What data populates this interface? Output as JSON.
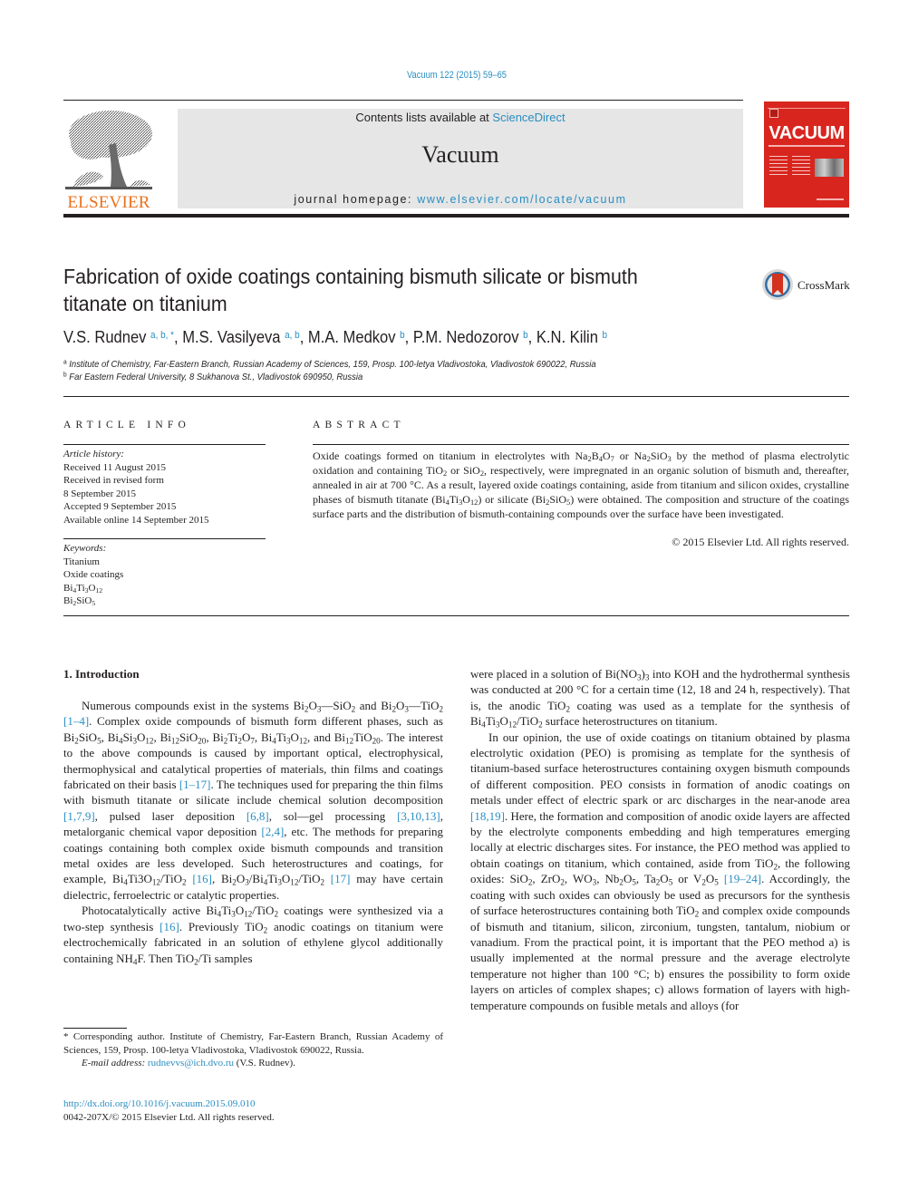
{
  "header": {
    "citation": "Vacuum 122 (2015) 59–65",
    "publisher_wordmark": "ELSEVIER",
    "contents_prefix": "Contents lists available at ",
    "contents_link": "ScienceDirect",
    "journal_title": "Vacuum",
    "homepage_prefix": "journal homepage: ",
    "homepage_link": "www.elsevier.com/locate/vacuum",
    "cover_title": "VACUUM",
    "crossmark_label": "CrossMark",
    "colors": {
      "link": "#2a8ec2",
      "elsevier_orange": "#e9711c",
      "cover_red": "#d8261f",
      "header_gray": "#e6e6e6"
    }
  },
  "article": {
    "title": "Fabrication of oxide coatings containing bismuth silicate or bismuth titanate on titanium",
    "authors": [
      {
        "name": "V.S. Rudnev",
        "marks": "a, b, *"
      },
      {
        "name": "M.S. Vasilyeva",
        "marks": "a, b"
      },
      {
        "name": "M.A. Medkov",
        "marks": "b"
      },
      {
        "name": "P.M. Nedozorov",
        "marks": "b"
      },
      {
        "name": "K.N. Kilin",
        "marks": "b"
      }
    ],
    "affiliations": [
      {
        "mark": "a",
        "text": "Institute of Chemistry, Far-Eastern Branch, Russian Academy of Sciences, 159, Prosp. 100-letya Vladivostoka, Vladivostok 690022, Russia"
      },
      {
        "mark": "b",
        "text": "Far Eastern Federal University, 8 Sukhanova St., Vladivostok 690950, Russia"
      }
    ]
  },
  "article_info": {
    "heading": "ARTICLE INFO",
    "history_label": "Article history:",
    "history": [
      "Received 11 August 2015",
      "Received in revised form",
      "8 September 2015",
      "Accepted 9 September 2015",
      "Available online 14 September 2015"
    ],
    "keywords_label": "Keywords:",
    "keywords": [
      [
        [
          "t",
          "Titanium"
        ]
      ],
      [
        [
          "t",
          "Oxide coatings"
        ]
      ],
      [
        [
          "t",
          "Bi"
        ],
        [
          "s",
          "4"
        ],
        [
          "t",
          "Ti"
        ],
        [
          "s",
          "3"
        ],
        [
          "t",
          "O"
        ],
        [
          "s",
          "12"
        ]
      ],
      [
        [
          "t",
          "Bi"
        ],
        [
          "s",
          "2"
        ],
        [
          "t",
          "SiO"
        ],
        [
          "s",
          "5"
        ]
      ]
    ]
  },
  "abstract": {
    "heading": "ABSTRACT",
    "text": [
      [
        "t",
        "Oxide coatings formed on titanium in electrolytes with Na"
      ],
      [
        "s",
        "2"
      ],
      [
        "t",
        "B"
      ],
      [
        "s",
        "4"
      ],
      [
        "t",
        "O"
      ],
      [
        "s",
        "7"
      ],
      [
        "t",
        " or Na"
      ],
      [
        "s",
        "2"
      ],
      [
        "t",
        "SiO"
      ],
      [
        "s",
        "3"
      ],
      [
        "t",
        " by the method of plasma electrolytic oxidation and containing TiO"
      ],
      [
        "s",
        "2"
      ],
      [
        "t",
        " or SiO"
      ],
      [
        "s",
        "2"
      ],
      [
        "t",
        ", respectively, were impregnated in an organic solution of bismuth and, thereafter, annealed in air at 700 °C. As a result, layered oxide coatings containing, aside from titanium and silicon oxides, crystalline phases of bismuth titanate (Bi"
      ],
      [
        "s",
        "4"
      ],
      [
        "t",
        "Ti"
      ],
      [
        "s",
        "3"
      ],
      [
        "t",
        "O"
      ],
      [
        "s",
        "12"
      ],
      [
        "t",
        ") or silicate (Bi"
      ],
      [
        "s",
        "2"
      ],
      [
        "t",
        "SiO"
      ],
      [
        "s",
        "5"
      ],
      [
        "t",
        ") were obtained. The composition and structure of the coatings surface parts and the distribution of bismuth-containing compounds over the surface have been investigated."
      ]
    ],
    "copyright": "© 2015 Elsevier Ltd. All rights reserved."
  },
  "body": {
    "section_heading": "1.  Introduction",
    "left_paragraphs": [
      [
        [
          "t",
          "Numerous compounds exist in the systems Bi"
        ],
        [
          "s",
          "2"
        ],
        [
          "t",
          "O"
        ],
        [
          "s",
          "3"
        ],
        [
          "t",
          "—SiO"
        ],
        [
          "s",
          "2"
        ],
        [
          "t",
          " and Bi"
        ],
        [
          "s",
          "2"
        ],
        [
          "t",
          "O"
        ],
        [
          "s",
          "3"
        ],
        [
          "t",
          "—TiO"
        ],
        [
          "s",
          "2"
        ],
        [
          "t",
          " "
        ],
        [
          "l",
          "[1–4]"
        ],
        [
          "t",
          ". Complex oxide compounds of bismuth form different phases, such as Bi"
        ],
        [
          "s",
          "2"
        ],
        [
          "t",
          "SiO"
        ],
        [
          "s",
          "5"
        ],
        [
          "t",
          ", Bi"
        ],
        [
          "s",
          "4"
        ],
        [
          "t",
          "Si"
        ],
        [
          "s",
          "3"
        ],
        [
          "t",
          "O"
        ],
        [
          "s",
          "12"
        ],
        [
          "t",
          ", Bi"
        ],
        [
          "s",
          "12"
        ],
        [
          "t",
          "SiO"
        ],
        [
          "s",
          "20"
        ],
        [
          "t",
          ", Bi"
        ],
        [
          "s",
          "2"
        ],
        [
          "t",
          "Ti"
        ],
        [
          "s",
          "2"
        ],
        [
          "t",
          "O"
        ],
        [
          "s",
          "7"
        ],
        [
          "t",
          ", Bi"
        ],
        [
          "s",
          "4"
        ],
        [
          "t",
          "Ti"
        ],
        [
          "s",
          "3"
        ],
        [
          "t",
          "O"
        ],
        [
          "s",
          "12"
        ],
        [
          "t",
          ", and Bi"
        ],
        [
          "s",
          "12"
        ],
        [
          "t",
          "TiO"
        ],
        [
          "s",
          "20"
        ],
        [
          "t",
          ". The interest to the above compounds is caused by important optical, electrophysical, thermophysical and catalytical properties of materials, thin films and coatings fabricated on their basis "
        ],
        [
          "l",
          "[1–17]"
        ],
        [
          "t",
          ". The techniques used for preparing the thin films with bismuth titanate or silicate include chemical solution decomposition "
        ],
        [
          "l",
          "[1,7,9]"
        ],
        [
          "t",
          ", pulsed laser deposition "
        ],
        [
          "l",
          "[6,8]"
        ],
        [
          "t",
          ", sol—gel processing "
        ],
        [
          "l",
          "[3,10,13]"
        ],
        [
          "t",
          ", metalorganic chemical vapor deposition "
        ],
        [
          "l",
          "[2,4]"
        ],
        [
          "t",
          ", etc. The methods for preparing coatings containing both complex oxide bismuth compounds and transition metal oxides are less developed. Such heterostructures and coatings, for example, Bi"
        ],
        [
          "s",
          "4"
        ],
        [
          "t",
          "Ti3O"
        ],
        [
          "s",
          "12"
        ],
        [
          "t",
          "/TiO"
        ],
        [
          "s",
          "2"
        ],
        [
          "t",
          " "
        ],
        [
          "l",
          "[16]"
        ],
        [
          "t",
          ", Bi"
        ],
        [
          "s",
          "2"
        ],
        [
          "t",
          "O"
        ],
        [
          "s",
          "3"
        ],
        [
          "t",
          "/Bi"
        ],
        [
          "s",
          "4"
        ],
        [
          "t",
          "Ti"
        ],
        [
          "s",
          "3"
        ],
        [
          "t",
          "O"
        ],
        [
          "s",
          "12"
        ],
        [
          "t",
          "/TiO"
        ],
        [
          "s",
          "2"
        ],
        [
          "t",
          " "
        ],
        [
          "l",
          "[17]"
        ],
        [
          "t",
          " may have certain dielectric, ferroelectric or catalytic properties."
        ]
      ],
      [
        [
          "t",
          "Photocatalytically active Bi"
        ],
        [
          "s",
          "4"
        ],
        [
          "t",
          "Ti"
        ],
        [
          "s",
          "3"
        ],
        [
          "t",
          "O"
        ],
        [
          "s",
          "12"
        ],
        [
          "t",
          "/TiO"
        ],
        [
          "s",
          "2"
        ],
        [
          "t",
          " coatings were synthesized via a two-step synthesis "
        ],
        [
          "l",
          "[16]"
        ],
        [
          "t",
          ". Previously TiO"
        ],
        [
          "s",
          "2"
        ],
        [
          "t",
          " anodic coatings on titanium were electrochemically fabricated in an solution of ethylene glycol additionally containing NH"
        ],
        [
          "s",
          "4"
        ],
        [
          "t",
          "F. Then TiO"
        ],
        [
          "s",
          "2"
        ],
        [
          "t",
          "/Ti samples"
        ]
      ]
    ],
    "right_paragraphs": [
      [
        [
          "t",
          "were placed in a solution of Bi(NO"
        ],
        [
          "s",
          "3"
        ],
        [
          "t",
          ")"
        ],
        [
          "s",
          "3"
        ],
        [
          "t",
          " into KOH and the hydrothermal synthesis was conducted at 200 °C for a certain time (12, 18 and 24 h, respectively). That is, the anodic TiO"
        ],
        [
          "s",
          "2"
        ],
        [
          "t",
          " coating was used as a template for the synthesis of Bi"
        ],
        [
          "s",
          "4"
        ],
        [
          "t",
          "Ti"
        ],
        [
          "s",
          "3"
        ],
        [
          "t",
          "O"
        ],
        [
          "s",
          "12"
        ],
        [
          "t",
          "/TiO"
        ],
        [
          "s",
          "2"
        ],
        [
          "t",
          " surface heterostructures on titanium."
        ]
      ],
      [
        [
          "t",
          "In our opinion, the use of oxide coatings on titanium obtained by plasma electrolytic oxidation (PEO) is promising as template for the synthesis of titanium-based surface heterostructures containing oxygen bismuth compounds of different composition. PEO consists in formation of anodic coatings on metals under effect of electric spark or arc discharges in the near-anode area "
        ],
        [
          "l",
          "[18,19]"
        ],
        [
          "t",
          ". Here, the formation and composition of anodic oxide layers are affected by the electrolyte components embedding and high temperatures emerging locally at electric discharges sites. For instance, the PEO method was applied to obtain coatings on titanium, which contained, aside from TiO"
        ],
        [
          "s",
          "2"
        ],
        [
          "t",
          ", the following oxides: SiO"
        ],
        [
          "s",
          "2"
        ],
        [
          "t",
          ", ZrO"
        ],
        [
          "s",
          "2"
        ],
        [
          "t",
          ", WO"
        ],
        [
          "s",
          "3"
        ],
        [
          "t",
          ", Nb"
        ],
        [
          "s",
          "2"
        ],
        [
          "t",
          "O"
        ],
        [
          "s",
          "5"
        ],
        [
          "t",
          ", Ta"
        ],
        [
          "s",
          "2"
        ],
        [
          "t",
          "O"
        ],
        [
          "s",
          "5"
        ],
        [
          "t",
          " or V"
        ],
        [
          "s",
          "2"
        ],
        [
          "t",
          "O"
        ],
        [
          "s",
          "5"
        ],
        [
          "t",
          " "
        ],
        [
          "l",
          "[19–24]"
        ],
        [
          "t",
          ". Accordingly, the coating with such oxides can obviously be used as precursors for the synthesis of surface heterostructures containing both TiO"
        ],
        [
          "s",
          "2"
        ],
        [
          "t",
          " and complex oxide compounds of bismuth and titanium, silicon, zirconium, tungsten, tantalum, niobium or vanadium. From the practical point, it is important that the PEO method a) is usually implemented at the normal pressure and the average electrolyte temperature not higher than 100 °C; b) ensures the possibility to form oxide layers on articles of complex shapes; c) allows formation of layers with high-temperature compounds on fusible metals and alloys (for"
        ]
      ]
    ]
  },
  "footnotes": {
    "corresponding": "* Corresponding author. Institute of Chemistry, Far-Eastern Branch, Russian Academy of Sciences, 159, Prosp. 100-letya Vladivostoka, Vladivostok 690022, Russia.",
    "email_label": "E-mail address: ",
    "email": "rudnevvs@ich.dvo.ru",
    "email_owner": " (V.S. Rudnev).",
    "doi": "http://dx.doi.org/10.1016/j.vacuum.2015.09.010",
    "issn_copyright": "0042-207X/© 2015 Elsevier Ltd. All rights reserved."
  }
}
